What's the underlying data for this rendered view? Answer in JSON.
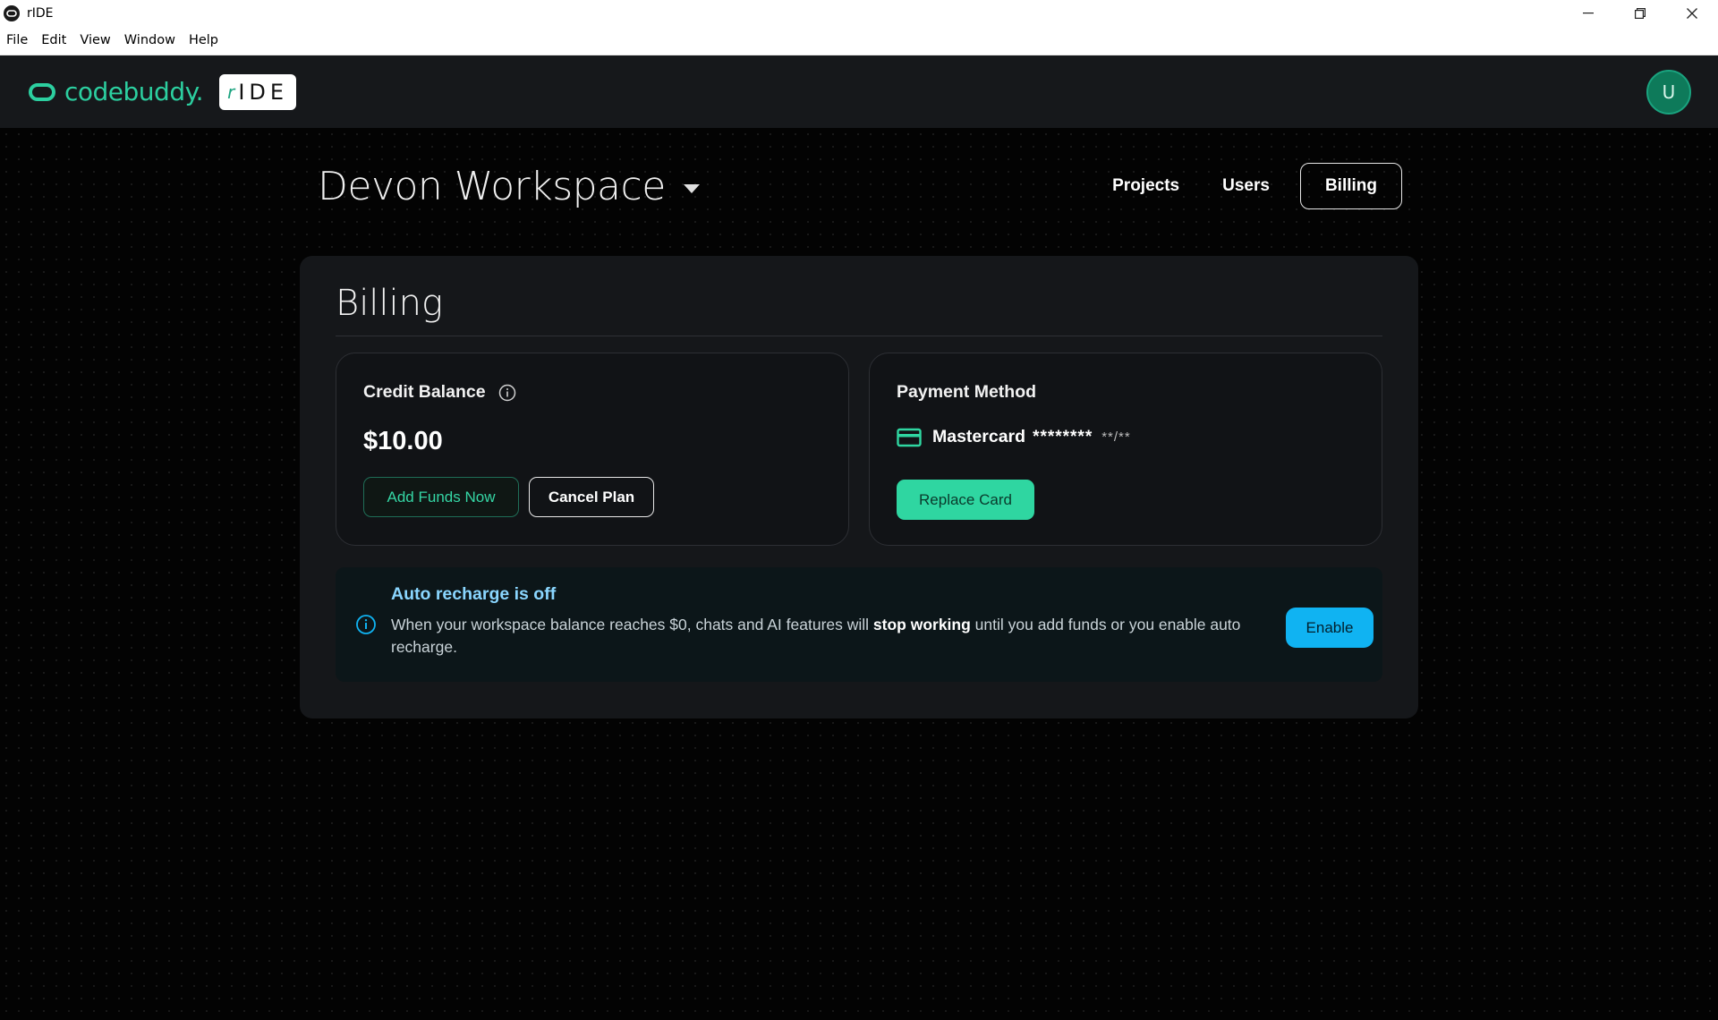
{
  "window": {
    "title": "rIDE",
    "minimize": "—",
    "restore": "❐",
    "close": "✕"
  },
  "menu": [
    "File",
    "Edit",
    "View",
    "Window",
    "Help"
  ],
  "header": {
    "brand_name": "codebuddy.",
    "badge_r": "r",
    "badge_text": "IDE",
    "avatar_initial": "U",
    "colors": {
      "brand": "#2ccfa0",
      "avatar_bg": "#0e7a5a"
    }
  },
  "workspace": {
    "name": "Devon Workspace"
  },
  "nav": {
    "projects": "Projects",
    "users": "Users",
    "billing": "Billing"
  },
  "billing": {
    "title": "Billing",
    "credit": {
      "heading": "Credit Balance",
      "amount": "$10.00",
      "add_funds": "Add Funds Now",
      "cancel_plan": "Cancel Plan"
    },
    "payment": {
      "heading": "Payment Method",
      "card_brand": "Mastercard",
      "card_mask": "********",
      "card_expiry": "**/**",
      "replace": "Replace Card"
    },
    "alert": {
      "title": "Auto recharge is off",
      "text_before": "When your workspace balance reaches $0, chats and AI features will ",
      "text_bold": "stop working",
      "text_after": " until you add funds or you enable auto recharge.",
      "enable": "Enable",
      "colors": {
        "title": "#8ad6ff",
        "button": "#10b3f2"
      }
    }
  }
}
